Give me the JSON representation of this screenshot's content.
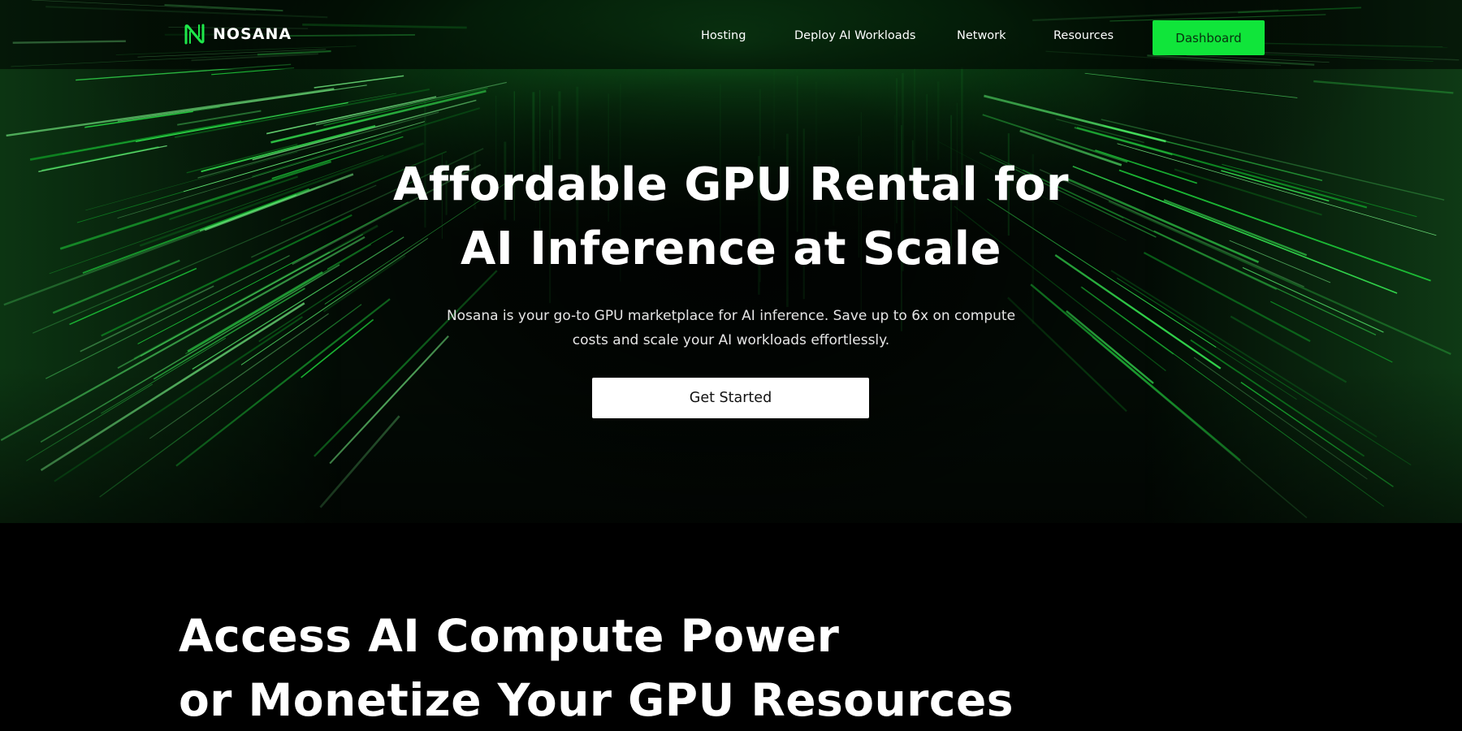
{
  "brand": {
    "name": "NOSANA",
    "logo_icon": "nosana-logo-mark",
    "accent_color": "#10e53a"
  },
  "nav": {
    "links": [
      "Hosting",
      "Deploy AI Workloads",
      "Network",
      "Resources"
    ],
    "dashboard_label": "Dashboard"
  },
  "hero": {
    "title_line1": "Affordable GPU Rental for",
    "title_line2": "AI Inference at Scale",
    "subtitle_line1": "Nosana is your go-to GPU marketplace for AI inference. Save up to 6x on compute",
    "subtitle_line2": "costs and scale your AI workloads effortlessly.",
    "cta_label": "Get Started",
    "background": "green-data-tunnel-image"
  },
  "section2": {
    "title_line1": "Access AI Compute Power",
    "title_line2": "or Monetize Your GPU Resources"
  }
}
